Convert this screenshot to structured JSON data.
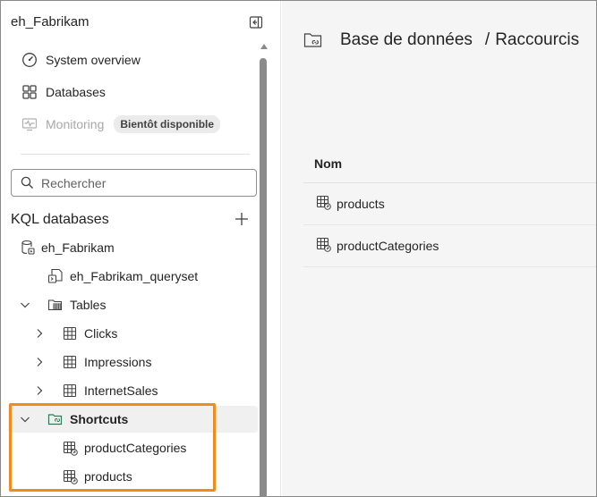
{
  "sidebar": {
    "workspace_title": "eh_Fabrikam",
    "nav": [
      {
        "label": "System overview",
        "icon": "gauge-icon"
      },
      {
        "label": "Databases",
        "icon": "grid-icon"
      },
      {
        "label": "Monitoring",
        "icon": "pulse-icon",
        "badge": "Bientôt disponible",
        "disabled": true
      }
    ],
    "search_placeholder": "Rechercher",
    "section_title": "KQL databases",
    "tree": {
      "database": "eh_Fabrikam",
      "queryset": "eh_Fabrikam_queryset",
      "tables_label": "Tables",
      "tables": [
        "Clicks",
        "Impressions",
        "InternetSales"
      ],
      "shortcuts_label": "Shortcuts",
      "shortcuts": [
        "productCategories",
        "products"
      ]
    }
  },
  "main": {
    "breadcrumb_db": "Base de données",
    "breadcrumb_sep": "/",
    "breadcrumb_page": "Raccourcis",
    "column_header": "Nom",
    "rows": [
      "products",
      "productCategories"
    ]
  },
  "colors": {
    "highlight": "#f08c1e",
    "shortcut_folder": "#2f7d52",
    "selected_row": "#f0f0f0"
  }
}
